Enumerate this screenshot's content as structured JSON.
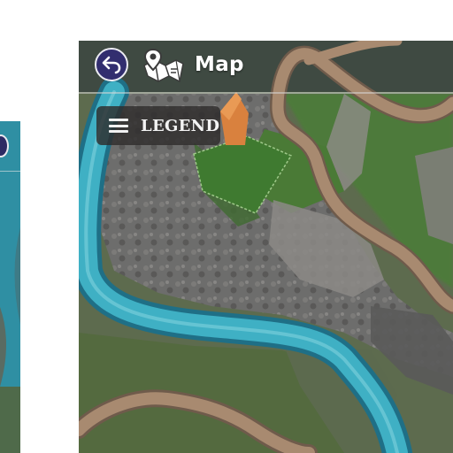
{
  "map": {
    "title": "Map",
    "legend_label": "LEGEND"
  },
  "icons": {
    "back": "back-arrow-icon",
    "map": "folded-map-pin-icon",
    "legend": "hamburger-menu-icon"
  },
  "colors": {
    "back_button_fill": "#322e6f",
    "river": "#3fb0c4",
    "road": "#a88a70",
    "grass": "#4f7a38",
    "rock": "#6f6e6c"
  }
}
